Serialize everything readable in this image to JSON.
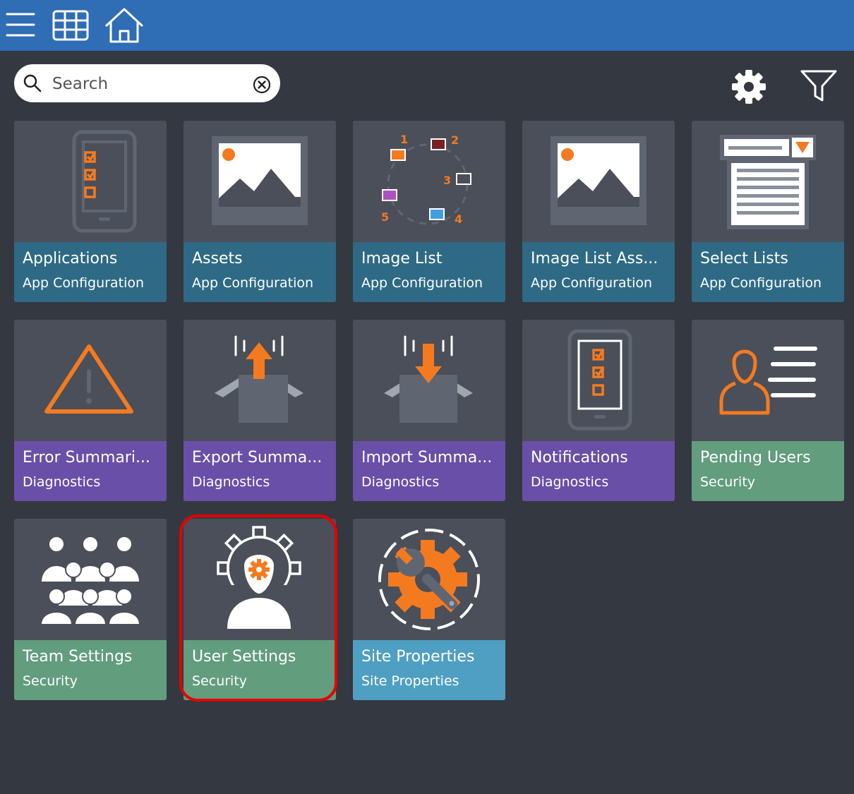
{
  "colors": {
    "header": "#2f6db5",
    "background": "#343841",
    "tile": "#4a4f59",
    "accent": "#f47a20",
    "app_configuration": "#2e6a85",
    "diagnostics": "#6a4fa8",
    "security": "#629d7e",
    "site_properties": "#4f9fc2",
    "highlight": "#e60000"
  },
  "header": {
    "icons": [
      "menu-icon",
      "grid-icon",
      "home-icon"
    ]
  },
  "search": {
    "placeholder": "Search",
    "value": ""
  },
  "toolbar": {
    "icons": [
      "gear-icon",
      "filter-icon"
    ]
  },
  "tiles": [
    {
      "title": "Applications",
      "category": "App Configuration",
      "icon": "mobile-checklist-icon"
    },
    {
      "title": "Assets",
      "category": "App Configuration",
      "icon": "image-icon"
    },
    {
      "title": "Image List",
      "category": "App Configuration",
      "icon": "image-cycle-icon",
      "numbers": [
        "1",
        "2",
        "3",
        "4",
        "5"
      ]
    },
    {
      "title": "Image List Ass...",
      "category": "App Configuration",
      "icon": "image-icon"
    },
    {
      "title": "Select Lists",
      "category": "App Configuration",
      "icon": "select-list-icon"
    },
    {
      "title": "Error Summari...",
      "category": "Diagnostics",
      "icon": "warning-icon"
    },
    {
      "title": "Export Summa...",
      "category": "Diagnostics",
      "icon": "box-export-icon"
    },
    {
      "title": "Import Summa...",
      "category": "Diagnostics",
      "icon": "box-import-icon"
    },
    {
      "title": "Notifications",
      "category": "Diagnostics",
      "icon": "mobile-checklist-icon"
    },
    {
      "title": "Pending Users",
      "category": "Security",
      "icon": "user-list-icon"
    },
    {
      "title": "Team Settings",
      "category": "Security",
      "icon": "team-icon"
    },
    {
      "title": "User Settings",
      "category": "Security",
      "icon": "user-gear-icon",
      "highlighted": true
    },
    {
      "title": "Site Properties",
      "category": "Site Properties",
      "icon": "wrench-gear-icon"
    }
  ]
}
